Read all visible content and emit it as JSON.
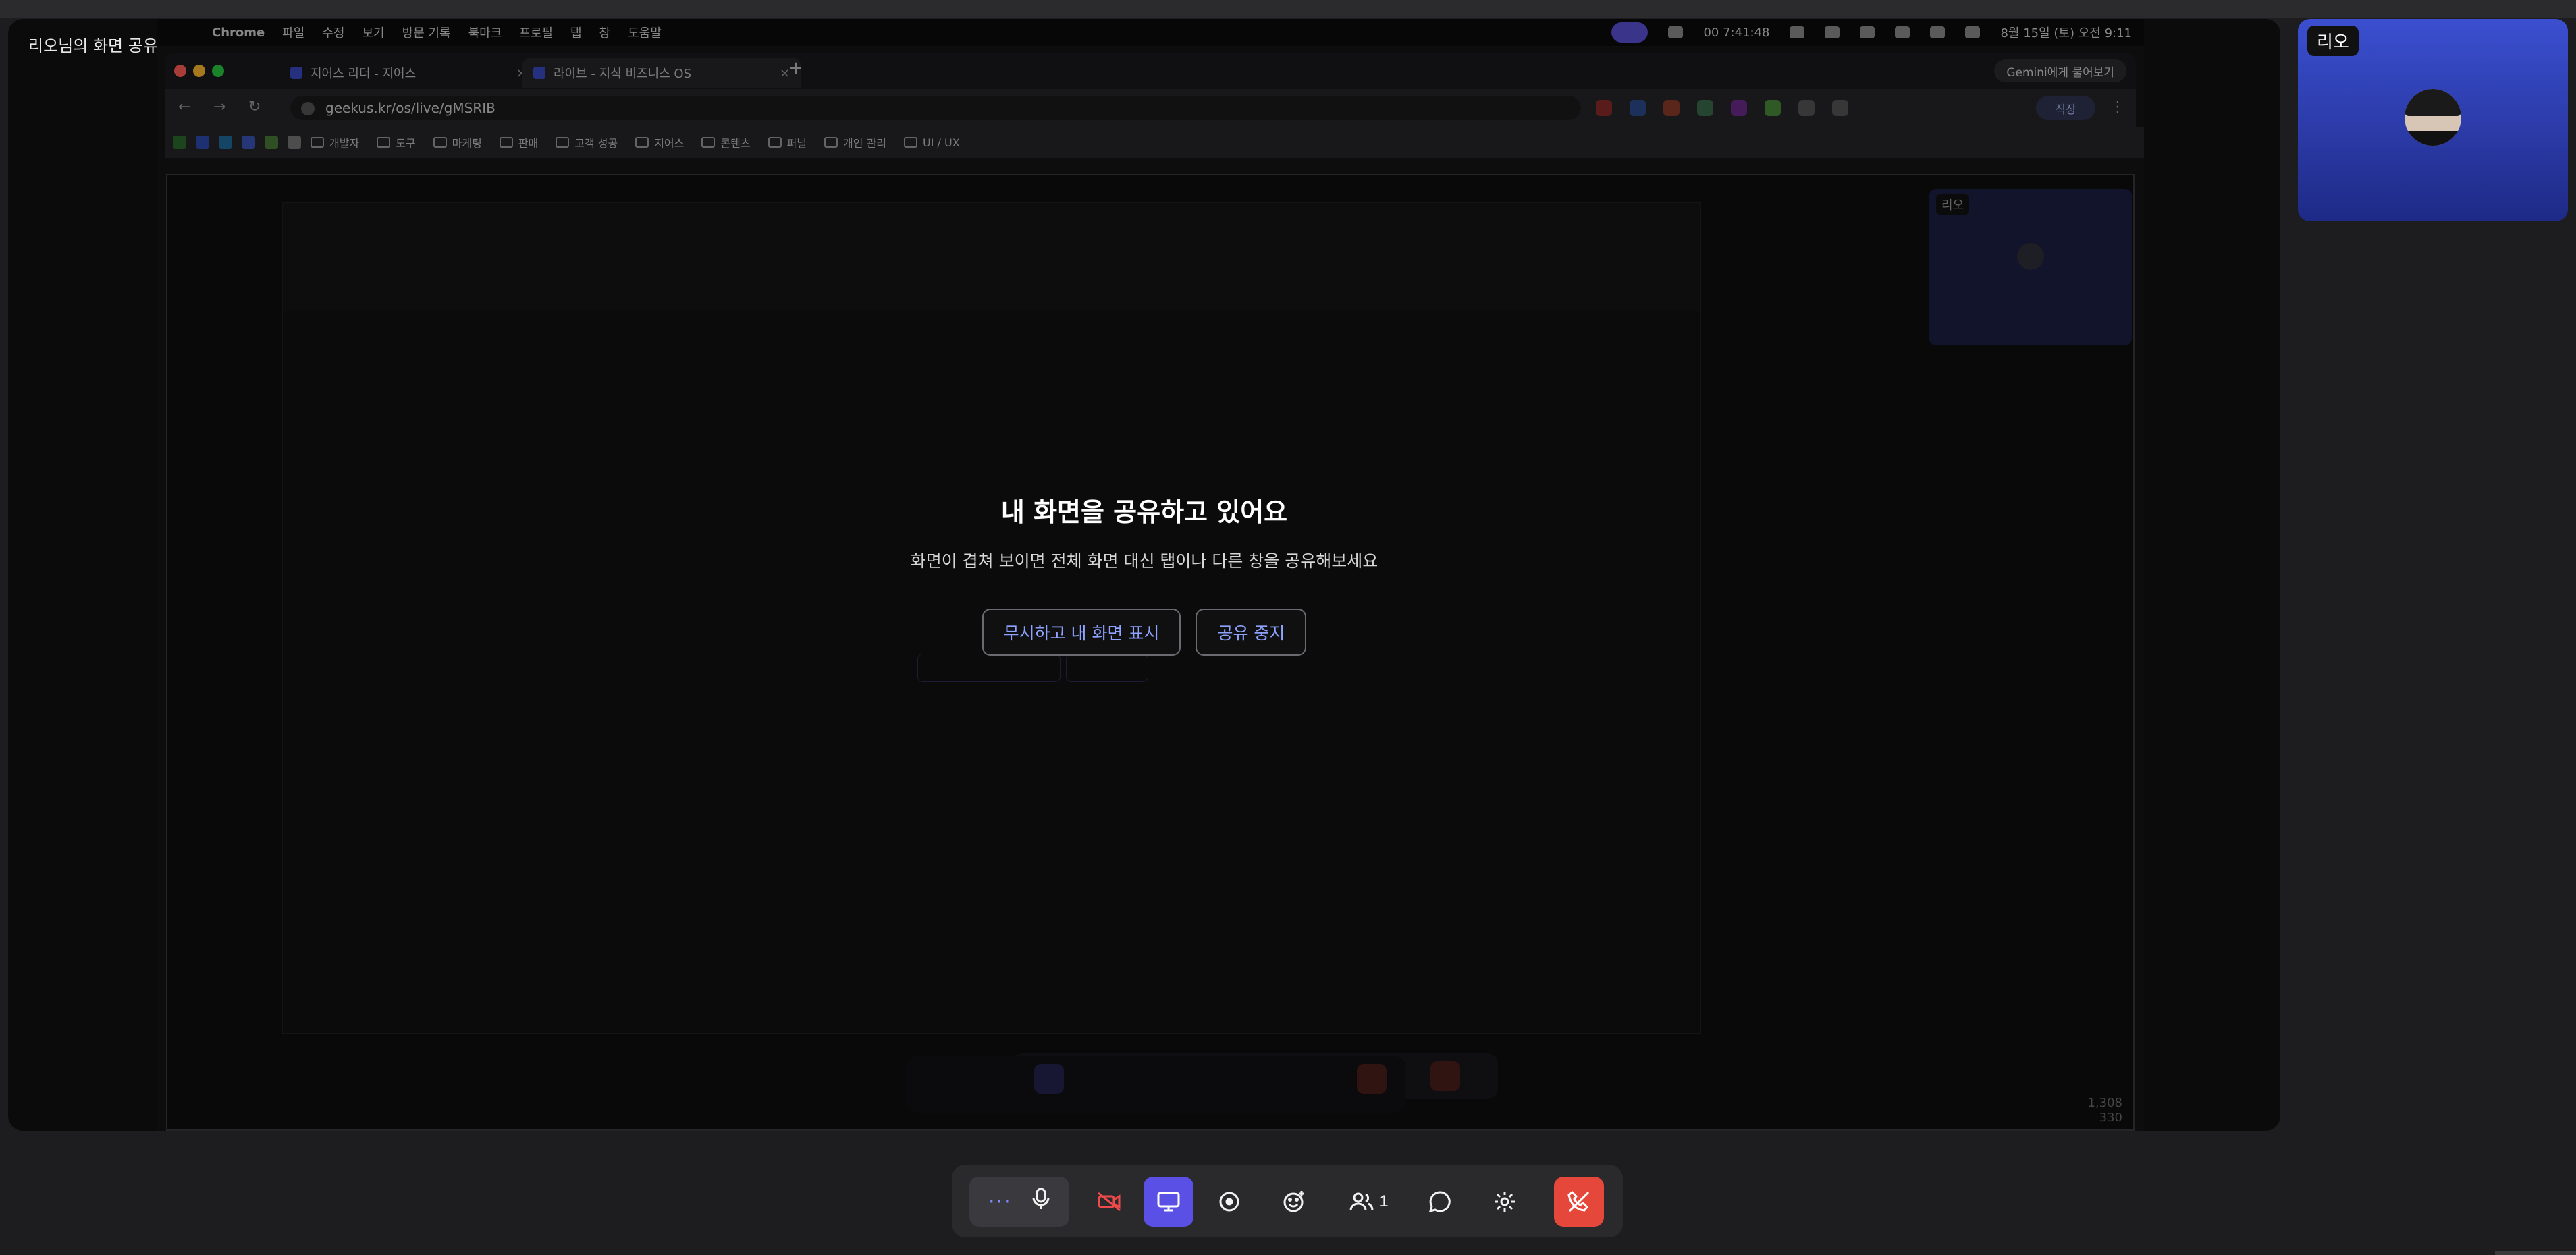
{
  "share_label": "리오님의 화면 공유",
  "menubar": {
    "items": [
      "Chrome",
      "파일",
      "수정",
      "보기",
      "방문 기록",
      "북마크",
      "프로필",
      "탭",
      "창",
      "도움말"
    ],
    "time_badge": "00 7:41:48",
    "datetime": "8월 15일 (토) 오전 9:11"
  },
  "tabs": [
    {
      "label": "지어스 리더 - 지어스",
      "active": false
    },
    {
      "label": "라이브 - 지식 비즈니스 OS",
      "active": true
    }
  ],
  "gemini_button": "Gemini에게 물어보기",
  "address": {
    "url": "geekus.kr/os/live/gMSRIB"
  },
  "profile_button": "직장",
  "bookmarks": [
    "개발자",
    "도구",
    "마케팅",
    "판매",
    "고객 성공",
    "지어스",
    "콘텐츠",
    "퍼널",
    "개인 관리",
    "UI / UX"
  ],
  "page_dims": {
    "w": "1,308",
    "h": "330"
  },
  "overlay": {
    "title": "내 화면을 공유하고 있어요",
    "subtitle": "화면이 겹쳐 보이면 전체 화면 대신 탭이나 다른 창을 공유해보세요",
    "ignore_button": "무시하고 내 화면 표시",
    "stop_button": "공유 중지"
  },
  "self_tile": {
    "name": "리오"
  },
  "toolbar": {
    "participants_count": "1"
  },
  "colors": {
    "accent": "#5b50e6",
    "end_call": "#e5483a",
    "cam_off": "#ee4a4a",
    "link_blue": "#8ea2ff"
  }
}
